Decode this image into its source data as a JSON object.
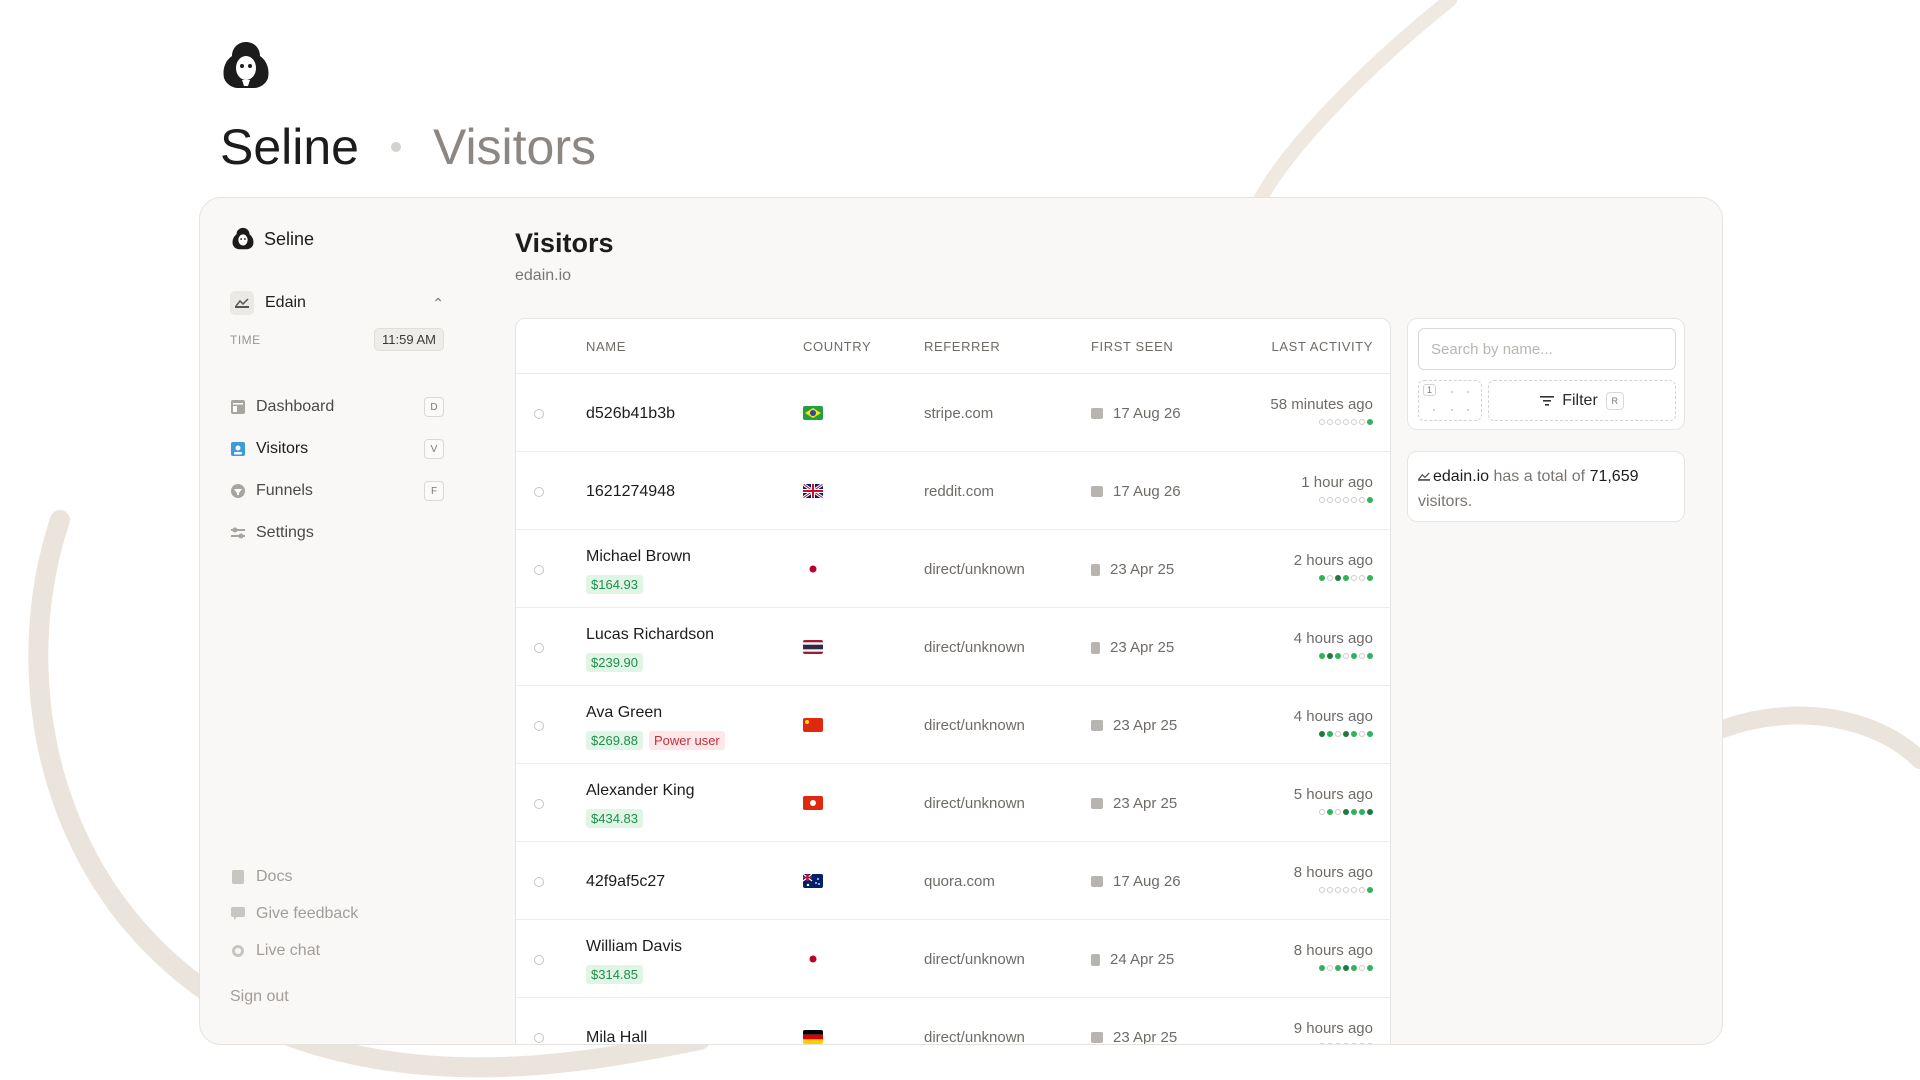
{
  "hero": {
    "brand": "Seline",
    "page": "Visitors"
  },
  "sidebar": {
    "brand": "Seline",
    "project": "Edain",
    "time_label": "TIME",
    "time_value": "11:59 AM",
    "nav": [
      {
        "label": "Dashboard",
        "shortcut": "D",
        "icon": "dashboard-icon"
      },
      {
        "label": "Visitors",
        "shortcut": "V",
        "icon": "visitors-icon"
      },
      {
        "label": "Funnels",
        "shortcut": "F",
        "icon": "funnels-icon"
      },
      {
        "label": "Settings",
        "shortcut": "",
        "icon": "settings-icon"
      }
    ],
    "bottom": [
      {
        "label": "Docs",
        "icon": "docs-icon"
      },
      {
        "label": "Give feedback",
        "icon": "feedback-icon"
      },
      {
        "label": "Live chat",
        "icon": "chat-icon"
      }
    ],
    "sign_out": "Sign out"
  },
  "main": {
    "title": "Visitors",
    "domain": "edain.io",
    "columns": {
      "name": "NAME",
      "country": "COUNTRY",
      "referrer": "REFERRER",
      "first_seen": "FIRST SEEN",
      "last_activity": "LAST ACTIVITY"
    },
    "rows": [
      {
        "name": "d526b41b3b",
        "money": "",
        "tag": "",
        "country": "brazil",
        "referrer": "stripe.com",
        "device": "desktop",
        "first_seen": "17 Aug 26",
        "last_activity": "58 minutes ago",
        "dots": [
          0,
          0,
          0,
          0,
          0,
          0,
          2
        ]
      },
      {
        "name": "1621274948",
        "money": "",
        "tag": "",
        "country": "uk",
        "referrer": "reddit.com",
        "device": "desktop",
        "first_seen": "17 Aug 26",
        "last_activity": "1 hour ago",
        "dots": [
          0,
          0,
          0,
          0,
          0,
          0,
          2
        ]
      },
      {
        "name": "Michael Brown",
        "money": "$164.93",
        "tag": "",
        "country": "japan",
        "referrer": "direct/unknown",
        "device": "phone",
        "first_seen": "23 Apr 25",
        "last_activity": "2 hours ago",
        "dots": [
          2,
          0,
          3,
          2,
          0,
          0,
          2
        ]
      },
      {
        "name": "Lucas Richardson",
        "money": "$239.90",
        "tag": "",
        "country": "thailand",
        "referrer": "direct/unknown",
        "device": "phone",
        "first_seen": "23 Apr 25",
        "last_activity": "4 hours ago",
        "dots": [
          2,
          3,
          2,
          0,
          2,
          0,
          2
        ]
      },
      {
        "name": "Ava Green",
        "money": "$269.88",
        "tag": "Power user",
        "country": "china",
        "referrer": "direct/unknown",
        "device": "desktop",
        "first_seen": "23 Apr 25",
        "last_activity": "4 hours ago",
        "dots": [
          3,
          2,
          0,
          3,
          2,
          0,
          2
        ]
      },
      {
        "name": "Alexander King",
        "money": "$434.83",
        "tag": "",
        "country": "hongkong",
        "referrer": "direct/unknown",
        "device": "desktop",
        "first_seen": "23 Apr 25",
        "last_activity": "5 hours ago",
        "dots": [
          0,
          2,
          0,
          3,
          2,
          2,
          3
        ]
      },
      {
        "name": "42f9af5c27",
        "money": "",
        "tag": "",
        "country": "australia",
        "referrer": "quora.com",
        "device": "desktop",
        "first_seen": "17 Aug 26",
        "last_activity": "8 hours ago",
        "dots": [
          0,
          0,
          0,
          0,
          0,
          0,
          2
        ]
      },
      {
        "name": "William Davis",
        "money": "$314.85",
        "tag": "",
        "country": "japan",
        "referrer": "direct/unknown",
        "device": "phone",
        "first_seen": "24 Apr 25",
        "last_activity": "8 hours ago",
        "dots": [
          2,
          0,
          2,
          3,
          2,
          0,
          2
        ]
      },
      {
        "name": "Mila Hall",
        "money": "",
        "tag": "",
        "country": "germany",
        "referrer": "direct/unknown",
        "device": "desktop",
        "first_seen": "23 Apr 25",
        "last_activity": "9 hours ago",
        "dots": [
          0,
          0,
          0,
          0,
          0,
          0,
          0
        ]
      }
    ]
  },
  "panel": {
    "search_placeholder": "Search by name...",
    "page_number": "1",
    "filter_label": "Filter",
    "filter_shortcut": "R",
    "total_domain": "edain.io",
    "total_text_before": " has a total of ",
    "total_count": "71,659",
    "total_text_after": " visitors."
  }
}
